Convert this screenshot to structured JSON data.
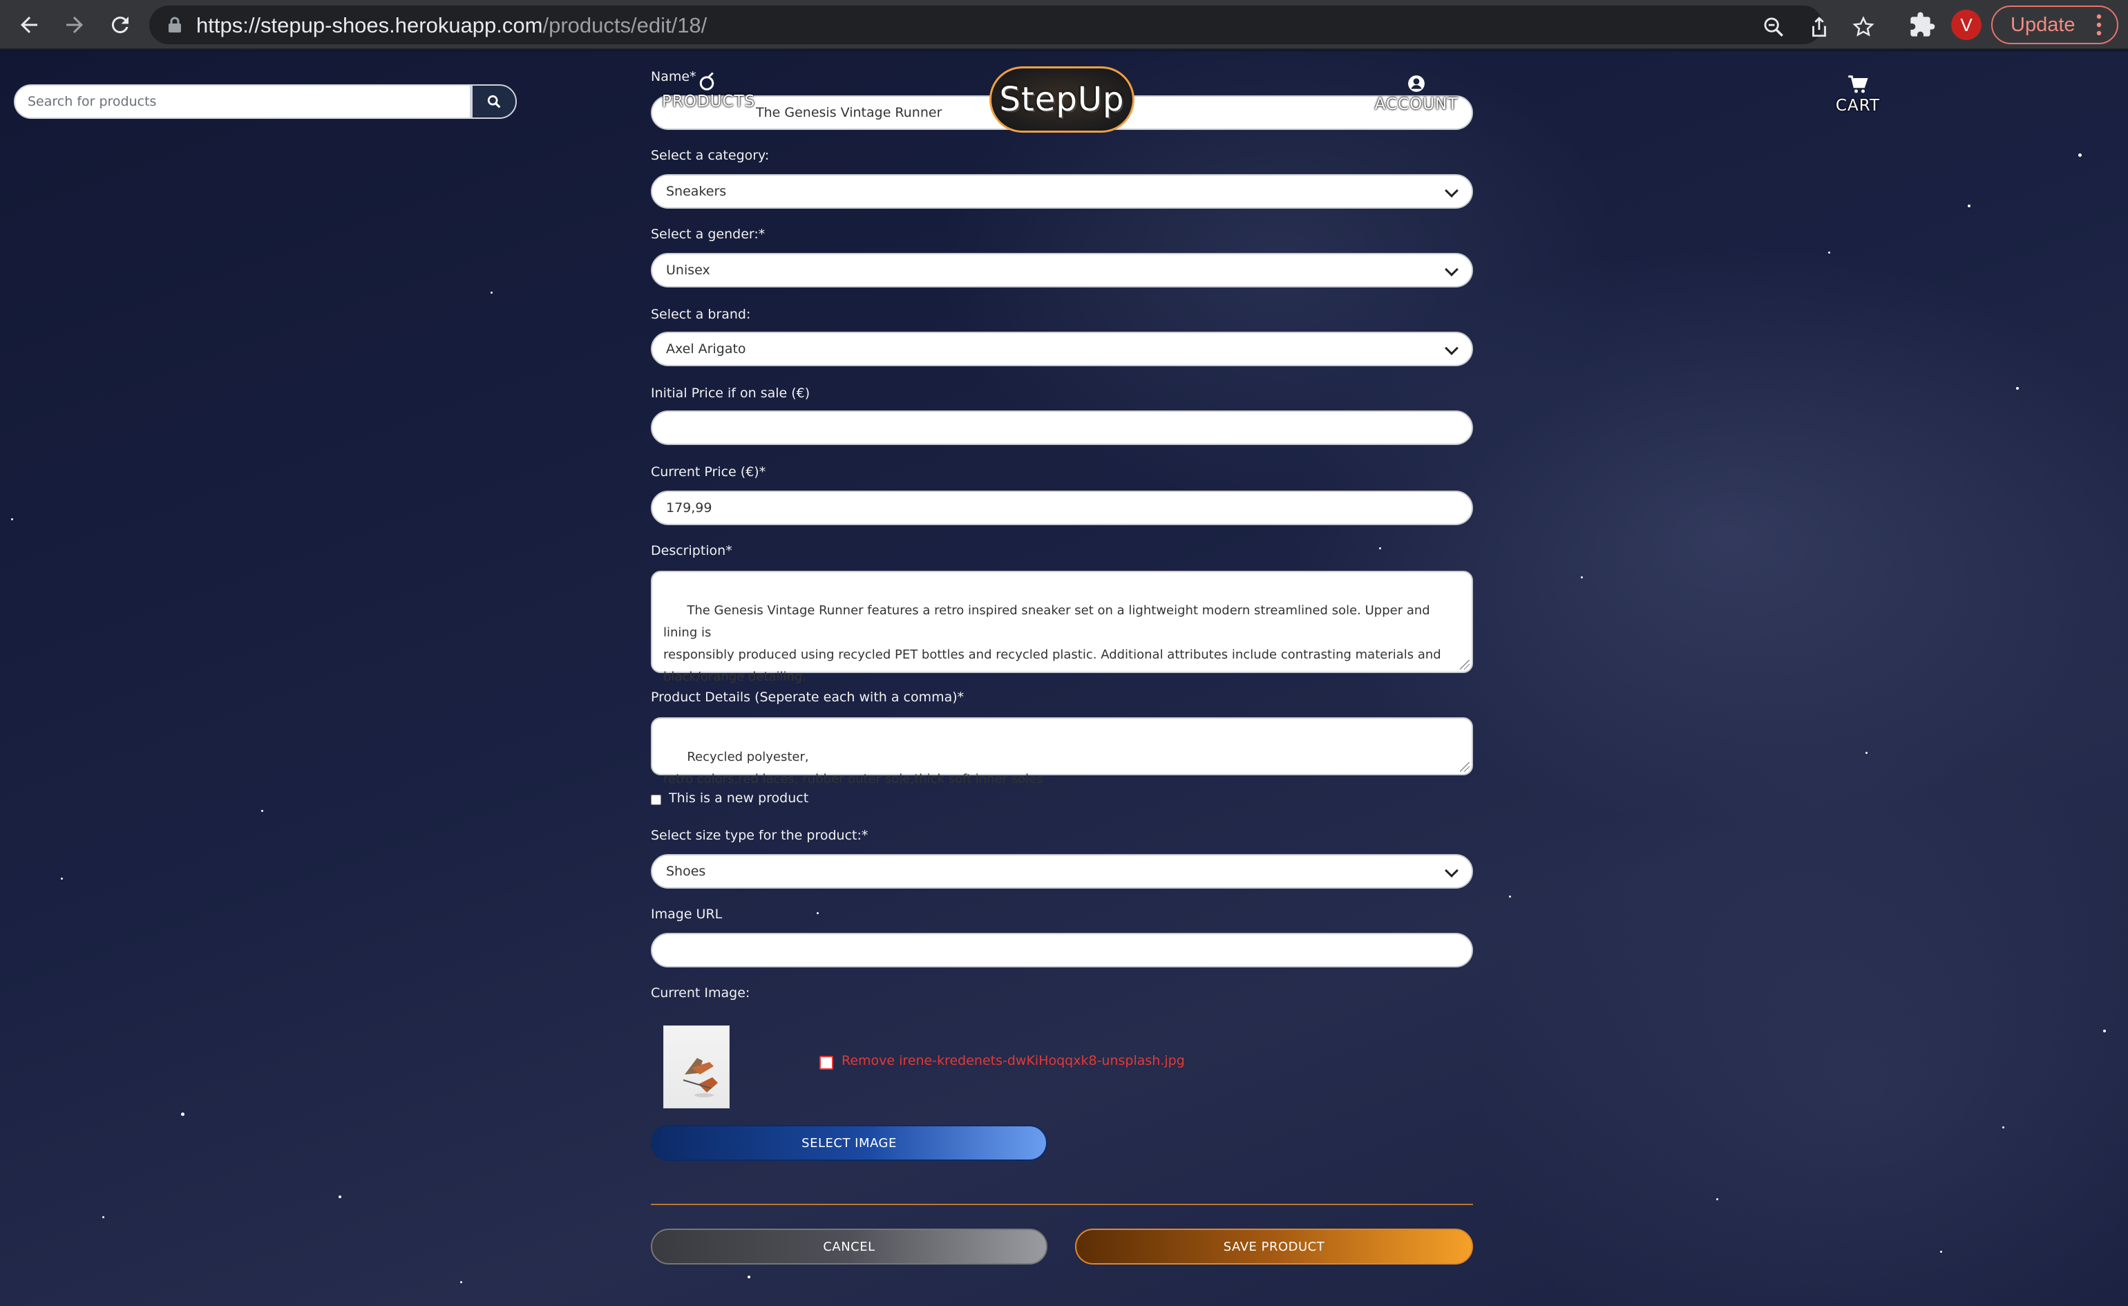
{
  "browser": {
    "url_host": "https://stepup-shoes.herokuapp.com",
    "url_path": "/products/edit/18/",
    "avatar_letter": "V",
    "update_label": "Update"
  },
  "header": {
    "search_placeholder": "Search for products",
    "products_label": "PRODUCTS",
    "logo_text": "StepUp",
    "account_label": "ACCOUNT",
    "cart_label": "CART"
  },
  "form": {
    "name_label": "Name*",
    "name_value": "The Genesis Vintage Runner",
    "category_label": "Select a category:",
    "category_value": "Sneakers",
    "gender_label": "Select a gender:*",
    "gender_value": "Unisex",
    "brand_label": "Select a brand:",
    "brand_value": "Axel Arigato",
    "initial_price_label": "Initial Price if on sale (€)",
    "initial_price_value": "",
    "current_price_label": "Current Price (€)*",
    "current_price_value": "179,99",
    "description_label": "Description*",
    "description_value": "The Genesis Vintage Runner features a retro inspired sneaker set on a lightweight modern streamlined sole. Upper and lining is\nresponsibly produced using recycled PET bottles and recycled plastic. Additional attributes include contrasting materials and\nblack/orange detailing.",
    "details_label": "Product Details (Seperate each with a comma)*",
    "details_value": "Recycled polyester,\nretro colors,red laces, rubber outer sole,thick soft inner soles",
    "new_product_label": "This is a new product",
    "new_product_checked": false,
    "size_type_label": "Select size type for the product:*",
    "size_type_value": "Shoes",
    "image_url_label": "Image URL",
    "image_url_value": "",
    "current_image_label": "Current Image:",
    "remove_image_label": "Remove irene-kredenets-dwKiHoqqxk8-unsplash.jpg",
    "select_image_label": "SELECT IMAGE",
    "cancel_label": "CANCEL",
    "save_label": "SAVE PRODUCT"
  },
  "colors": {
    "accent_orange": "#f5a028",
    "accent_blue": "#1b4aa3",
    "remove_red": "#e53935"
  }
}
